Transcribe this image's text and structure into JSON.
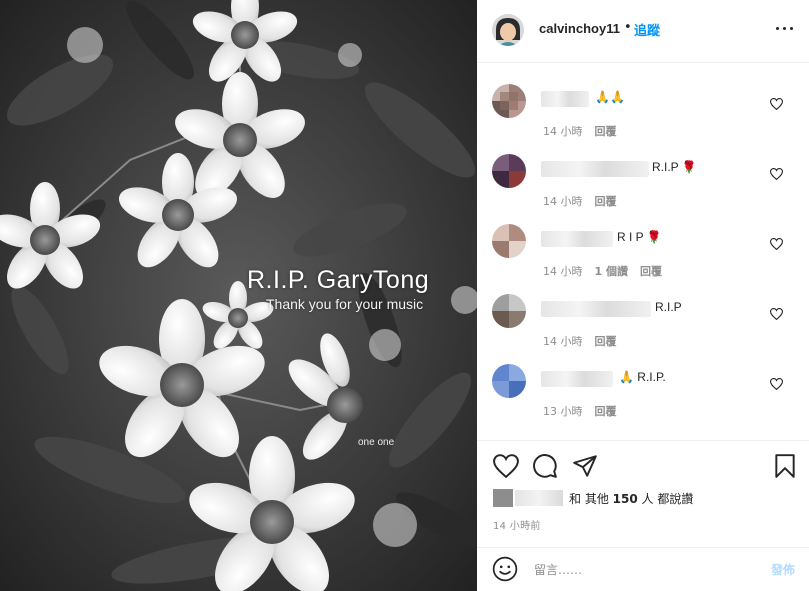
{
  "photo": {
    "title": "R.I.P. GaryTong",
    "subtitle": "Thank you for your music",
    "signature": "one one"
  },
  "header": {
    "username": "calvinchoy11",
    "separator": "•",
    "follow_label": "追蹤",
    "more_icon": "more-options-icon"
  },
  "comments": [
    {
      "text": "🙏🙏",
      "time": "14 小時",
      "likes": "",
      "reply": "回覆"
    },
    {
      "text": "R.I.P 🌹",
      "time": "14 小時",
      "likes": "",
      "reply": "回覆"
    },
    {
      "text": "R I P 🌹",
      "time": "14 小時",
      "likes": "1 個讚",
      "reply": "回覆"
    },
    {
      "text": "R.I.P",
      "time": "14 小時",
      "likes": "",
      "reply": "回覆"
    },
    {
      "text": "🙏 R.I.P.",
      "time": "13 小時",
      "likes": "",
      "reply": "回覆"
    }
  ],
  "likes": {
    "prefix": "和 其他 ",
    "count": "150",
    "suffix": " 人 都說讚"
  },
  "time_ago": "14 小時前",
  "add_comment": {
    "placeholder": "留言……",
    "post_label": "發佈"
  },
  "colors": {
    "accent": "#0095f6",
    "post_disabled": "#b3dbff",
    "text": "#262626",
    "muted": "#8e8e8e"
  }
}
